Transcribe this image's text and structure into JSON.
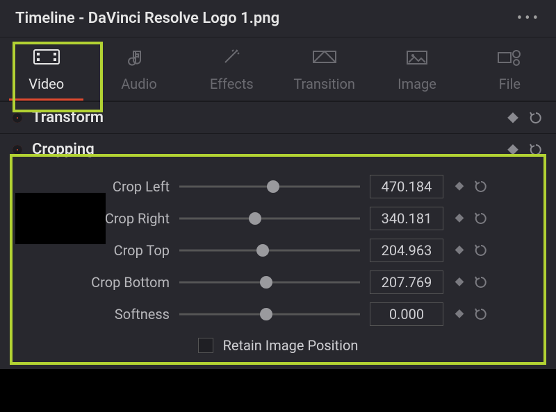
{
  "title": "Timeline - DaVinci Resolve Logo 1.png",
  "tabs": {
    "video": "Video",
    "audio": "Audio",
    "effects": "Effects",
    "transition": "Transition",
    "image": "Image",
    "file": "File"
  },
  "sections": {
    "transform": {
      "title": "Transform"
    },
    "cropping": {
      "title": "Cropping",
      "params": {
        "crop_left": {
          "label": "Crop Left",
          "value": "470.184",
          "pos": 0.52
        },
        "crop_right": {
          "label": "Crop Right",
          "value": "340.181",
          "pos": 0.42
        },
        "crop_top": {
          "label": "Crop Top",
          "value": "204.963",
          "pos": 0.46
        },
        "crop_bottom": {
          "label": "Crop Bottom",
          "value": "207.769",
          "pos": 0.48
        },
        "softness": {
          "label": "Softness",
          "value": "0.000",
          "pos": 0.48
        }
      },
      "retain": {
        "label": "Retain Image Position",
        "checked": false
      }
    }
  },
  "icons": {
    "keyframe": "kf",
    "reset": "reset"
  }
}
